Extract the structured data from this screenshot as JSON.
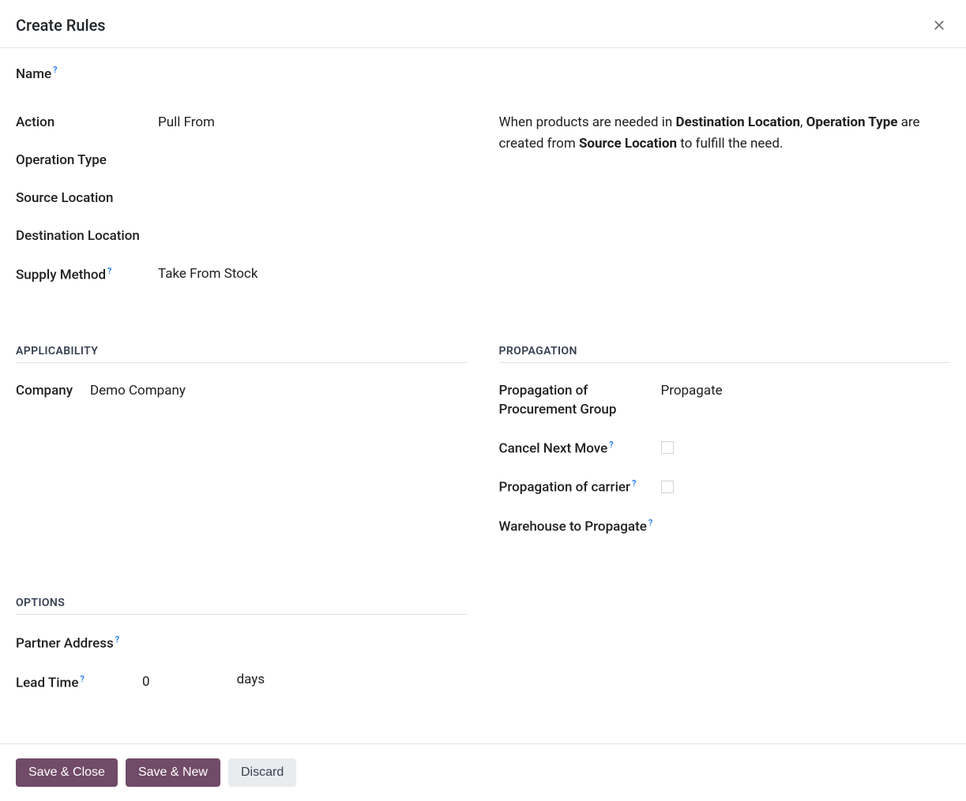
{
  "header": {
    "title": "Create Rules"
  },
  "fields": {
    "name_label": "Name",
    "action_label": "Action",
    "action_value": "Pull From",
    "operation_type_label": "Operation Type",
    "source_location_label": "Source Location",
    "destination_location_label": "Destination Location",
    "supply_method_label": "Supply Method",
    "supply_method_value": "Take From Stock"
  },
  "explain": {
    "t1": "When products are needed in ",
    "b1": "Destination Location",
    "t2": ", ",
    "b2": "Operation Type",
    "t3": " are created from ",
    "b3": "Source Location",
    "t4": " to fulfill the need."
  },
  "sections": {
    "applicability": "APPLICABILITY",
    "propagation": "PROPAGATION",
    "options": "OPTIONS"
  },
  "applicability": {
    "company_label": "Company",
    "company_value": "Demo Company"
  },
  "propagation": {
    "procurement_group_label": "Propagation of Procurement Group",
    "procurement_group_value": "Propagate",
    "cancel_next_move_label": "Cancel Next Move",
    "carrier_label": "Propagation of carrier",
    "warehouse_label": "Warehouse to Propagate"
  },
  "options": {
    "partner_address_label": "Partner Address",
    "lead_time_label": "Lead Time",
    "lead_time_value": "0",
    "lead_time_unit": "days"
  },
  "footer": {
    "save_close": "Save & Close",
    "save_new": "Save & New",
    "discard": "Discard"
  },
  "help_marker": "?"
}
